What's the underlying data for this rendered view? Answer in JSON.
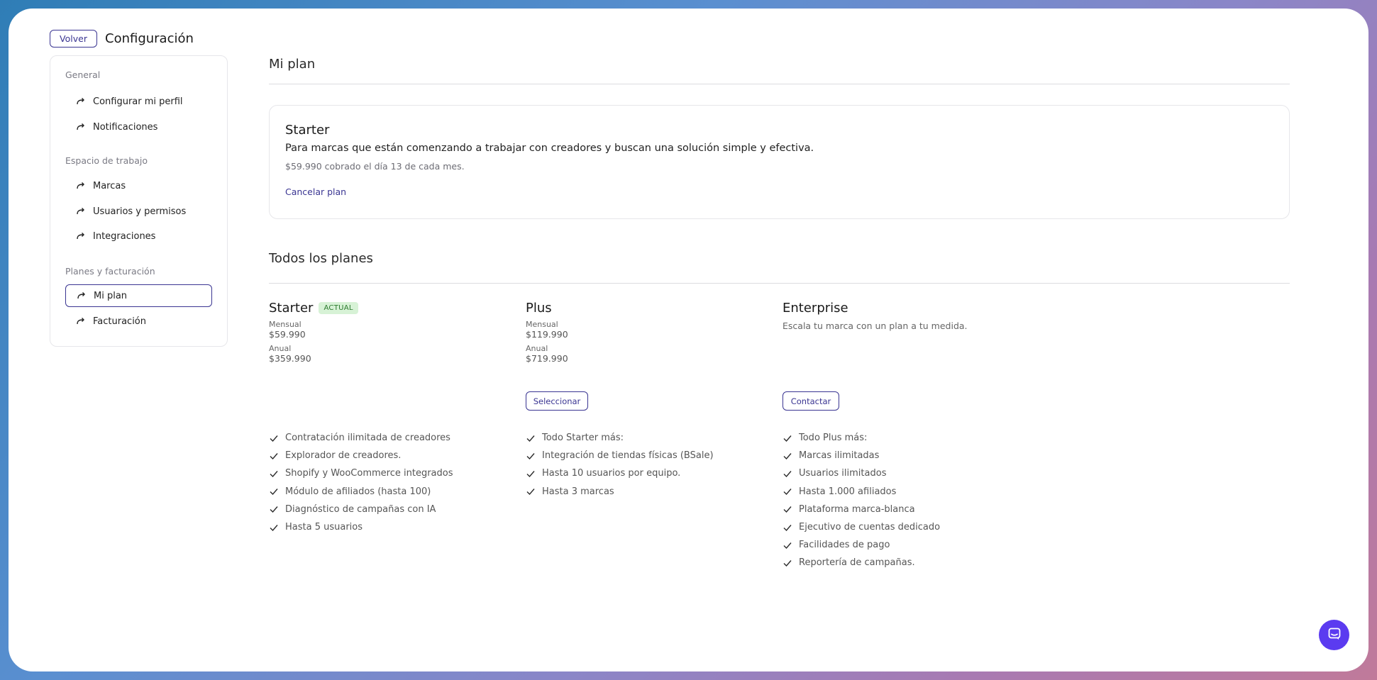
{
  "header": {
    "back_label": "Volver",
    "title": "Configuración"
  },
  "sidebar": {
    "sections": [
      {
        "label": "General",
        "items": [
          {
            "label": "Configurar mi perfil"
          },
          {
            "label": "Notificaciones"
          }
        ]
      },
      {
        "label": "Espacio de trabajo",
        "items": [
          {
            "label": "Marcas"
          },
          {
            "label": "Usuarios y permisos"
          },
          {
            "label": "Integraciones"
          }
        ]
      },
      {
        "label": "Planes y facturación",
        "items": [
          {
            "label": "Mi plan",
            "active": true
          },
          {
            "label": "Facturación"
          }
        ]
      }
    ]
  },
  "my_plan": {
    "title": "Mi plan",
    "current": {
      "name": "Starter",
      "description": "Para marcas que están comenzando a trabajar con creadores y buscan una solución simple y efectiva.",
      "billing_note": "$59.990 cobrado el día 13 de cada mes.",
      "cancel_label": "Cancelar plan"
    }
  },
  "all_plans": {
    "title": "Todos los planes",
    "plans": [
      {
        "name": "Starter",
        "badge": "ACTUAL",
        "monthly_label": "Mensual",
        "monthly_price": "$59.990",
        "annual_label": "Anual",
        "annual_price": "$359.990",
        "features": [
          "Contratación ilimitada de creadores",
          "Explorador de creadores.",
          "Shopify y WooCommerce integrados",
          "Módulo de afiliados (hasta 100)",
          "Diagnóstico de campañas con IA",
          "Hasta 5 usuarios"
        ]
      },
      {
        "name": "Plus",
        "monthly_label": "Mensual",
        "monthly_price": "$119.990",
        "annual_label": "Anual",
        "annual_price": "$719.990",
        "button_label": "Seleccionar",
        "features": [
          "Todo Starter más:",
          "Integración de tiendas físicas (BSale)",
          "Hasta 10 usuarios por equipo.",
          "Hasta 3 marcas"
        ]
      },
      {
        "name": "Enterprise",
        "description": "Escala tu marca con un plan a tu medida.",
        "button_label": "Contactar",
        "features": [
          "Todo Plus más:",
          "Marcas ilimitadas",
          "Usuarios ilimitados",
          "Hasta 1.000 afiliados",
          "Plataforma marca-blanca",
          "Ejecutivo de cuentas dedicado",
          "Facilidades de pago",
          "Reportería de campañas."
        ]
      }
    ]
  },
  "colors": {
    "accent": "#3a3592",
    "badge_bg": "#d7f2d6",
    "badge_text": "#2c7a2e",
    "chat_button": "#5b3bf0"
  },
  "icons": {
    "nav_item": "redo-arrow-icon",
    "feature": "check-icon",
    "chat": "chat-icon"
  }
}
